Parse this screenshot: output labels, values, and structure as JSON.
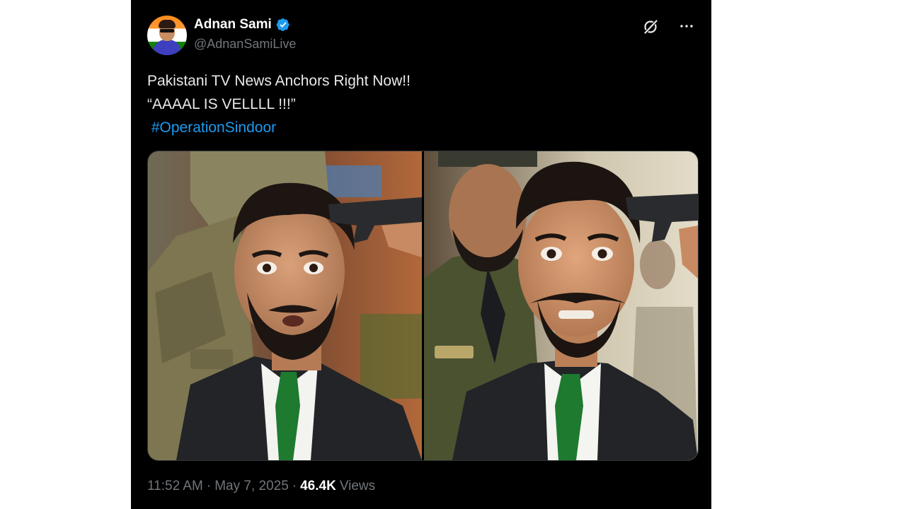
{
  "tweet": {
    "author": {
      "display_name": "Adnan Sami",
      "handle": "@AdnanSamiLive",
      "verified_icon": "verified-badge-icon",
      "avatar": "avatar"
    },
    "text_lines": [
      "Pakistani TV News Anchors Right Now!!",
      "“AAAAL IS VELLLL !!!”"
    ],
    "hashtag": " #OperationSindoor",
    "actions": {
      "grok_icon": "grok-icon",
      "more_icon": "more-icon"
    },
    "timestamp": {
      "time": "11:52 AM",
      "date": "May 7, 2025"
    },
    "separator": "·",
    "views": {
      "count": "46.4K",
      "label": "Views"
    },
    "colors": {
      "background": "#000000",
      "text": "#e7e9ea",
      "secondary_text": "#71767b",
      "link": "#1d9bf0",
      "verified": "#1d9bf0"
    }
  }
}
